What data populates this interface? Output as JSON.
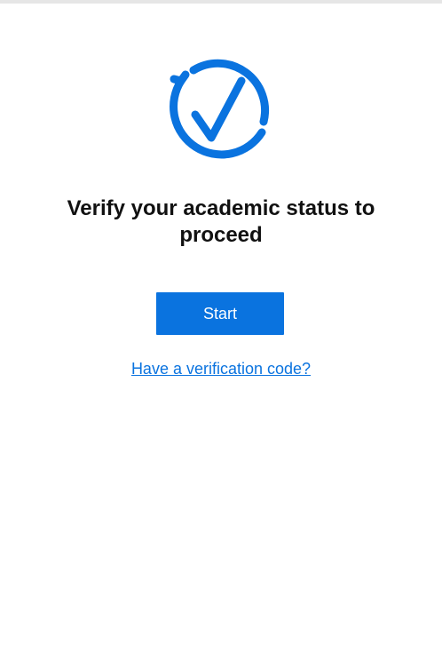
{
  "header": {
    "icon": "verified-check-cycle-icon",
    "title": "Verify your academic status to proceed"
  },
  "actions": {
    "start_label": "Start",
    "verification_code_link": "Have a verification code?"
  },
  "colors": {
    "accent": "#0a73df",
    "text": "#111111",
    "background": "#ffffff"
  }
}
